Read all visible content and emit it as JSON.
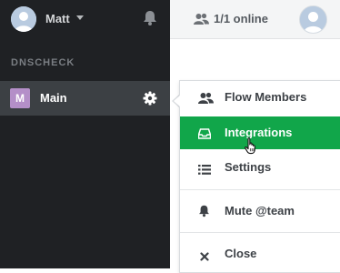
{
  "user": {
    "name": "Matt"
  },
  "organization": {
    "label": "DNSCHECK"
  },
  "flow": {
    "name": "Main",
    "avatar_letter": "M",
    "avatar_color": "#b48fc8"
  },
  "header": {
    "online_status": "1/1 online"
  },
  "menu": {
    "items": [
      {
        "label": "Flow Members",
        "icon": "people-icon"
      },
      {
        "label": "Integrations",
        "icon": "inbox-icon",
        "active": true
      },
      {
        "label": "Settings",
        "icon": "list-icon"
      },
      {
        "label": "Mute @team",
        "icon": "bell-icon"
      },
      {
        "label": "Close",
        "icon": "close-icon"
      }
    ]
  },
  "colors": {
    "sidebar": "#1f2124",
    "active_flow": "#3c4044",
    "accent": "#11a64a"
  }
}
